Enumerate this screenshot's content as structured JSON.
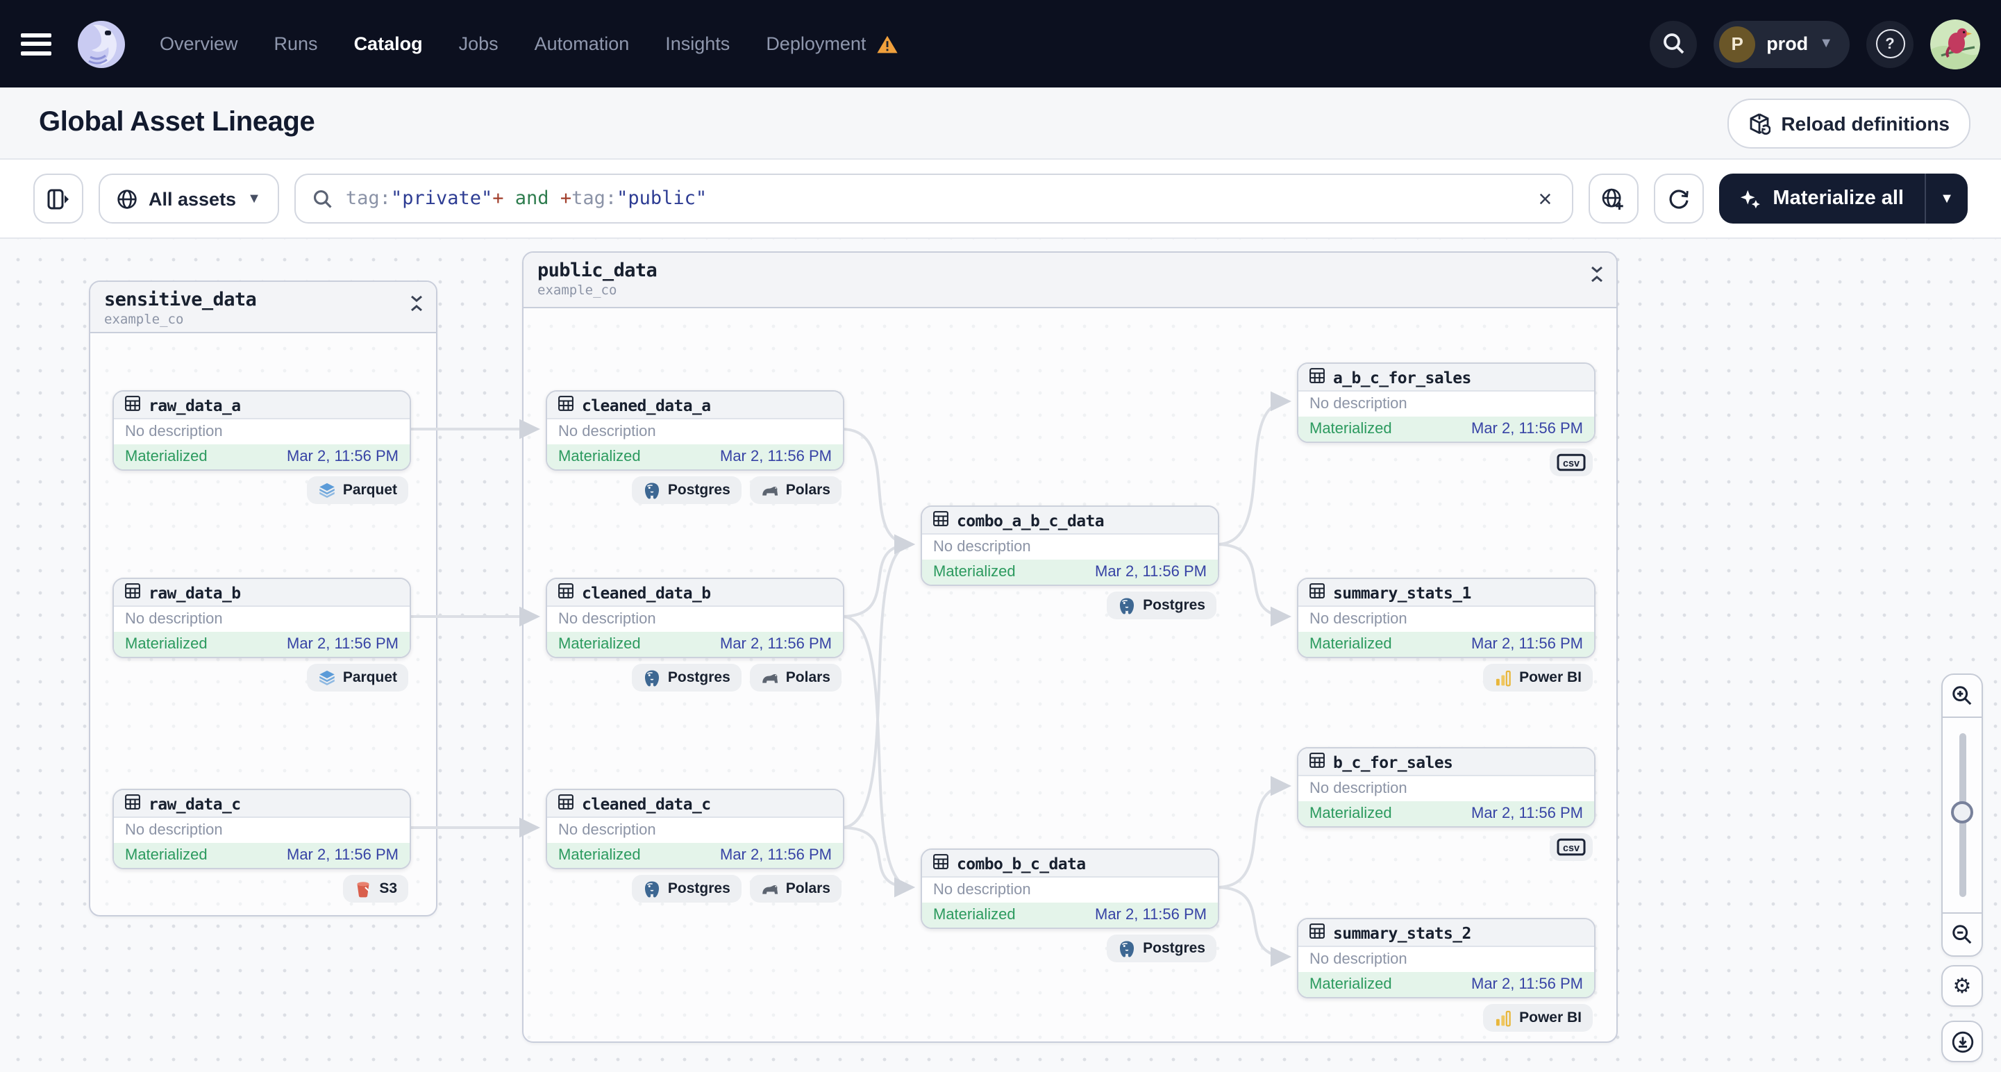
{
  "colors": {
    "nav_bg": "#0c101f",
    "dark_button": "#141c31",
    "status_green": "#2b9a5e",
    "status_green_bg": "#e4f4ea",
    "timestamp_indigo": "#3743a5",
    "warning_orange": "#f0a03c",
    "query_key": "#8b93a7",
    "query_value": "#2d3c93",
    "query_op": "#a23f2c",
    "query_bool": "#2f7d4f",
    "edge_gray": "#dcdfe5"
  },
  "nav": {
    "menu": [
      {
        "label": "Overview",
        "active": false,
        "warning": false
      },
      {
        "label": "Runs",
        "active": false,
        "warning": false
      },
      {
        "label": "Catalog",
        "active": true,
        "warning": false
      },
      {
        "label": "Jobs",
        "active": false,
        "warning": false
      },
      {
        "label": "Automation",
        "active": false,
        "warning": false
      },
      {
        "label": "Insights",
        "active": false,
        "warning": false
      },
      {
        "label": "Deployment",
        "active": false,
        "warning": true
      }
    ],
    "environment": {
      "initial": "P",
      "label": "prod"
    },
    "icons": [
      "hamburger-icon",
      "dagster-logo",
      "search-icon",
      "help-icon",
      "user-avatar"
    ]
  },
  "header": {
    "title": "Global Asset Lineage",
    "reload_button": "Reload definitions"
  },
  "toolbar": {
    "scope": {
      "label": "All assets",
      "icon": "globe-icon"
    },
    "query": {
      "tokens": [
        {
          "text": "tag:",
          "role": "key"
        },
        {
          "text": "\"private\"",
          "role": "value"
        },
        {
          "text": "+",
          "role": "op"
        },
        {
          "text": " and ",
          "role": "bool"
        },
        {
          "text": "+",
          "role": "op"
        },
        {
          "text": "tag:",
          "role": "key"
        },
        {
          "text": "\"public\"",
          "role": "value"
        }
      ]
    },
    "clear_label": "×",
    "materialize": {
      "label": "Materialize all",
      "icon": "sparkle-icon"
    },
    "icons": [
      "panel-toggle-icon",
      "globe-add-icon",
      "refresh-icon"
    ]
  },
  "graph": {
    "groups": [
      {
        "id": "sensitive_data",
        "title": "sensitive_data",
        "subtitle": "example_co"
      },
      {
        "id": "public_data",
        "title": "public_data",
        "subtitle": "example_co"
      }
    ],
    "nodes": [
      {
        "id": "raw_data_a",
        "group": "sensitive_data",
        "title": "raw_data_a",
        "description": "No description",
        "status": "Materialized",
        "timestamp": "Mar 2, 11:56 PM",
        "badges": [
          {
            "label": "Parquet",
            "icon": "parquet"
          }
        ]
      },
      {
        "id": "raw_data_b",
        "group": "sensitive_data",
        "title": "raw_data_b",
        "description": "No description",
        "status": "Materialized",
        "timestamp": "Mar 2, 11:56 PM",
        "badges": [
          {
            "label": "Parquet",
            "icon": "parquet"
          }
        ]
      },
      {
        "id": "raw_data_c",
        "group": "sensitive_data",
        "title": "raw_data_c",
        "description": "No description",
        "status": "Materialized",
        "timestamp": "Mar 2, 11:56 PM",
        "badges": [
          {
            "label": "S3",
            "icon": "s3"
          }
        ]
      },
      {
        "id": "cleaned_data_a",
        "group": "public_data",
        "title": "cleaned_data_a",
        "description": "No description",
        "status": "Materialized",
        "timestamp": "Mar 2, 11:56 PM",
        "badges": [
          {
            "label": "Postgres",
            "icon": "postgres"
          },
          {
            "label": "Polars",
            "icon": "polars"
          }
        ]
      },
      {
        "id": "cleaned_data_b",
        "group": "public_data",
        "title": "cleaned_data_b",
        "description": "No description",
        "status": "Materialized",
        "timestamp": "Mar 2, 11:56 PM",
        "badges": [
          {
            "label": "Postgres",
            "icon": "postgres"
          },
          {
            "label": "Polars",
            "icon": "polars"
          }
        ]
      },
      {
        "id": "cleaned_data_c",
        "group": "public_data",
        "title": "cleaned_data_c",
        "description": "No description",
        "status": "Materialized",
        "timestamp": "Mar 2, 11:56 PM",
        "badges": [
          {
            "label": "Postgres",
            "icon": "postgres"
          },
          {
            "label": "Polars",
            "icon": "polars"
          }
        ]
      },
      {
        "id": "combo_a_b_c_data",
        "group": "public_data",
        "title": "combo_a_b_c_data",
        "description": "No description",
        "status": "Materialized",
        "timestamp": "Mar 2, 11:56 PM",
        "badges": [
          {
            "label": "Postgres",
            "icon": "postgres"
          }
        ]
      },
      {
        "id": "combo_b_c_data",
        "group": "public_data",
        "title": "combo_b_c_data",
        "description": "No description",
        "status": "Materialized",
        "timestamp": "Mar 2, 11:56 PM",
        "badges": [
          {
            "label": "Postgres",
            "icon": "postgres"
          }
        ]
      },
      {
        "id": "a_b_c_for_sales",
        "group": "public_data",
        "title": "a_b_c_for_sales",
        "description": "No description",
        "status": "Materialized",
        "timestamp": "Mar 2, 11:56 PM",
        "badges": [
          {
            "label": "csv",
            "icon": "csv",
            "icon_only": true
          }
        ]
      },
      {
        "id": "summary_stats_1",
        "group": "public_data",
        "title": "summary_stats_1",
        "description": "No description",
        "status": "Materialized",
        "timestamp": "Mar 2, 11:56 PM",
        "badges": [
          {
            "label": "Power BI",
            "icon": "powerbi"
          }
        ]
      },
      {
        "id": "b_c_for_sales",
        "group": "public_data",
        "title": "b_c_for_sales",
        "description": "No description",
        "status": "Materialized",
        "timestamp": "Mar 2, 11:56 PM",
        "badges": [
          {
            "label": "csv",
            "icon": "csv",
            "icon_only": true
          }
        ]
      },
      {
        "id": "summary_stats_2",
        "group": "public_data",
        "title": "summary_stats_2",
        "description": "No description",
        "status": "Materialized",
        "timestamp": "Mar 2, 11:56 PM",
        "badges": [
          {
            "label": "Power BI",
            "icon": "powerbi"
          }
        ]
      }
    ],
    "edges": [
      {
        "from": "raw_data_a",
        "to": "cleaned_data_a"
      },
      {
        "from": "raw_data_b",
        "to": "cleaned_data_b"
      },
      {
        "from": "raw_data_c",
        "to": "cleaned_data_c"
      },
      {
        "from": "cleaned_data_a",
        "to": "combo_a_b_c_data"
      },
      {
        "from": "cleaned_data_b",
        "to": "combo_a_b_c_data"
      },
      {
        "from": "cleaned_data_c",
        "to": "combo_a_b_c_data"
      },
      {
        "from": "cleaned_data_b",
        "to": "combo_b_c_data"
      },
      {
        "from": "cleaned_data_c",
        "to": "combo_b_c_data"
      },
      {
        "from": "combo_a_b_c_data",
        "to": "a_b_c_for_sales"
      },
      {
        "from": "combo_a_b_c_data",
        "to": "summary_stats_1"
      },
      {
        "from": "combo_b_c_data",
        "to": "b_c_for_sales"
      },
      {
        "from": "combo_b_c_data",
        "to": "summary_stats_2"
      }
    ]
  },
  "zoom_panel": {
    "icons": [
      "zoom-in-icon",
      "zoom-out-icon",
      "settings-gear-icon",
      "download-icon"
    ]
  }
}
